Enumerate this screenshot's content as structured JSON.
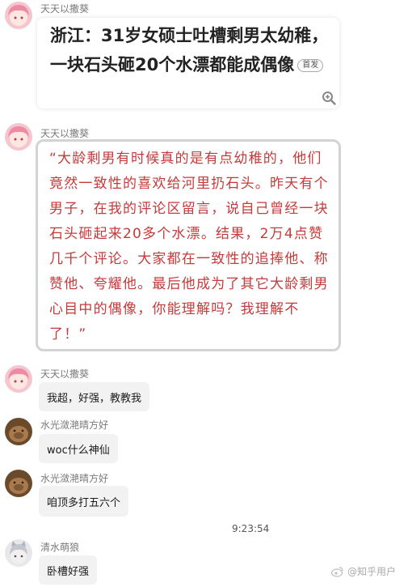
{
  "messages": [
    {
      "sender": "天天以撒葵",
      "news_card": {
        "title": "浙江：31岁女硕士吐槽剩男太幼稚，一块石头砸20个水漂都能成偶像",
        "tag": "首发"
      }
    },
    {
      "sender": "天天以撒葵",
      "quote": "“大龄剩男有时候真的是有点幼稚的，他们竟然一致性的喜欢给河里扔石头。昨天有个男子，在我的评论区留言，说自己曾经一块石头砸起来20多个水漂。结果，2万4点赞几千个评论。大家都在一致性的追捧他、称赞他、夸耀他。最后他成为了其它大龄剩男心目中的偶像，你能理解吗？我理解不了！”"
    },
    {
      "sender": "天天以撒葵",
      "text": "我超，好强，教教我"
    },
    {
      "sender": "水光潋滟晴方好",
      "text": "woc什么神仙"
    },
    {
      "sender": "水光潋滟晴方好",
      "text": "咱顶多打五六个"
    },
    {
      "sender": "清水萌狼",
      "text": "卧槽好强"
    }
  ],
  "timestamp": "9:23:54",
  "watermark": "@知乎用户"
}
